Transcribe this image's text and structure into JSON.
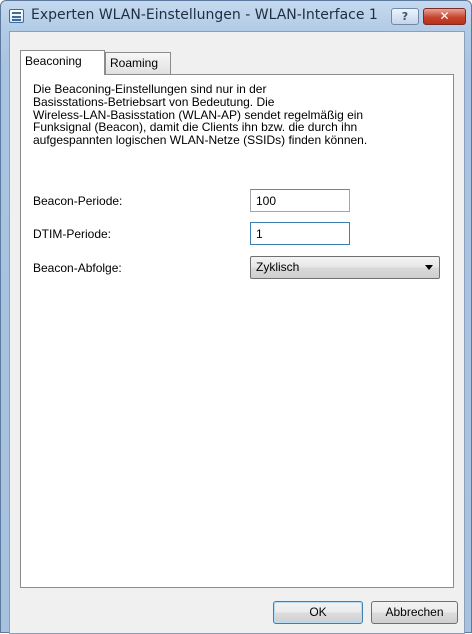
{
  "window": {
    "title": "Experten WLAN-Einstellungen - WLAN-Interface 1",
    "help_label": "?",
    "close_label": "✕"
  },
  "tabs": [
    {
      "label": "Beaconing",
      "active": true
    },
    {
      "label": "Roaming",
      "active": false
    }
  ],
  "description": [
    "Die Beaconing-Einstellungen sind nur in der",
    "Basisstations-Betriebsart von Bedeutung. Die",
    "Wireless-LAN-Basisstation (WLAN-AP) sendet regelmäßig ein",
    "Funksignal (Beacon), damit die Clients ihn bzw. die durch ihn",
    "aufgespannten logischen WLAN-Netze (SSIDs) finden können."
  ],
  "fields": {
    "beacon_period": {
      "label": "Beacon-Periode:",
      "value": "100"
    },
    "dtim_period": {
      "label": "DTIM-Periode:",
      "value": "1"
    },
    "beacon_order": {
      "label": "Beacon-Abfolge:",
      "value": "Zyklisch"
    }
  },
  "buttons": {
    "ok": "OK",
    "cancel": "Abbrechen"
  }
}
